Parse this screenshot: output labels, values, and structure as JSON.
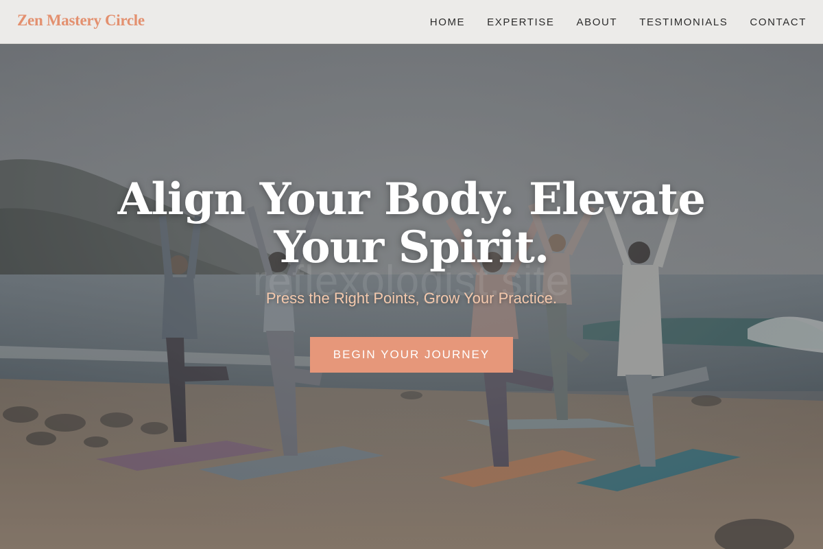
{
  "header": {
    "brand": "Zen Mastery Circle",
    "nav": [
      "HOME",
      "EXPERTISE",
      "ABOUT",
      "TESTIMONIALS",
      "CONTACT"
    ]
  },
  "hero": {
    "title": "Align Your Body. Elevate Your Spirit.",
    "subtitle": "Press the Right Points, Grow Your Practice.",
    "cta_label": "BEGIN YOUR JOURNEY",
    "watermark": "reflexologist.site"
  },
  "colors": {
    "accent": "#e6977a",
    "brand": "#e3906f",
    "header_bg": "#ecebe9",
    "subtitle": "#f4c9ad"
  }
}
